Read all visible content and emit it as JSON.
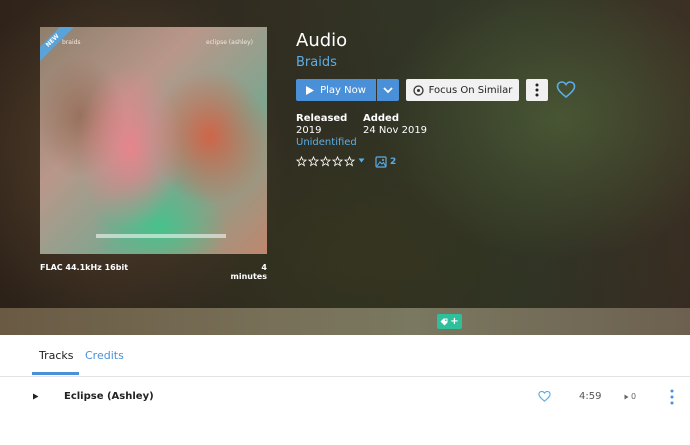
{
  "album": {
    "badge": "NEW",
    "cover_artist_text": "braids",
    "cover_title_text": "eclipse (ashley)",
    "format": "FLAC 44.1kHz 16bit",
    "duration": "4 minutes",
    "title": "Audio",
    "artist": "Braids"
  },
  "actions": {
    "play_label": "Play Now",
    "focus_label": "Focus On Similar"
  },
  "info": {
    "released_label": "Released",
    "released_value": "2019",
    "released_link": "Unidentified",
    "added_label": "Added",
    "added_value": "24 Nov 2019"
  },
  "rating": {
    "stars": 0,
    "max": 5
  },
  "gallery": {
    "count": "2"
  },
  "tabs": {
    "tracks": "Tracks",
    "credits": "Credits"
  },
  "tracks": [
    {
      "title": "Eclipse (Ashley)",
      "duration": "4:59",
      "plays": "0"
    }
  ],
  "colors": {
    "accent": "#4a90d9",
    "link": "#5aaee8",
    "tag": "#2fbf9a"
  }
}
